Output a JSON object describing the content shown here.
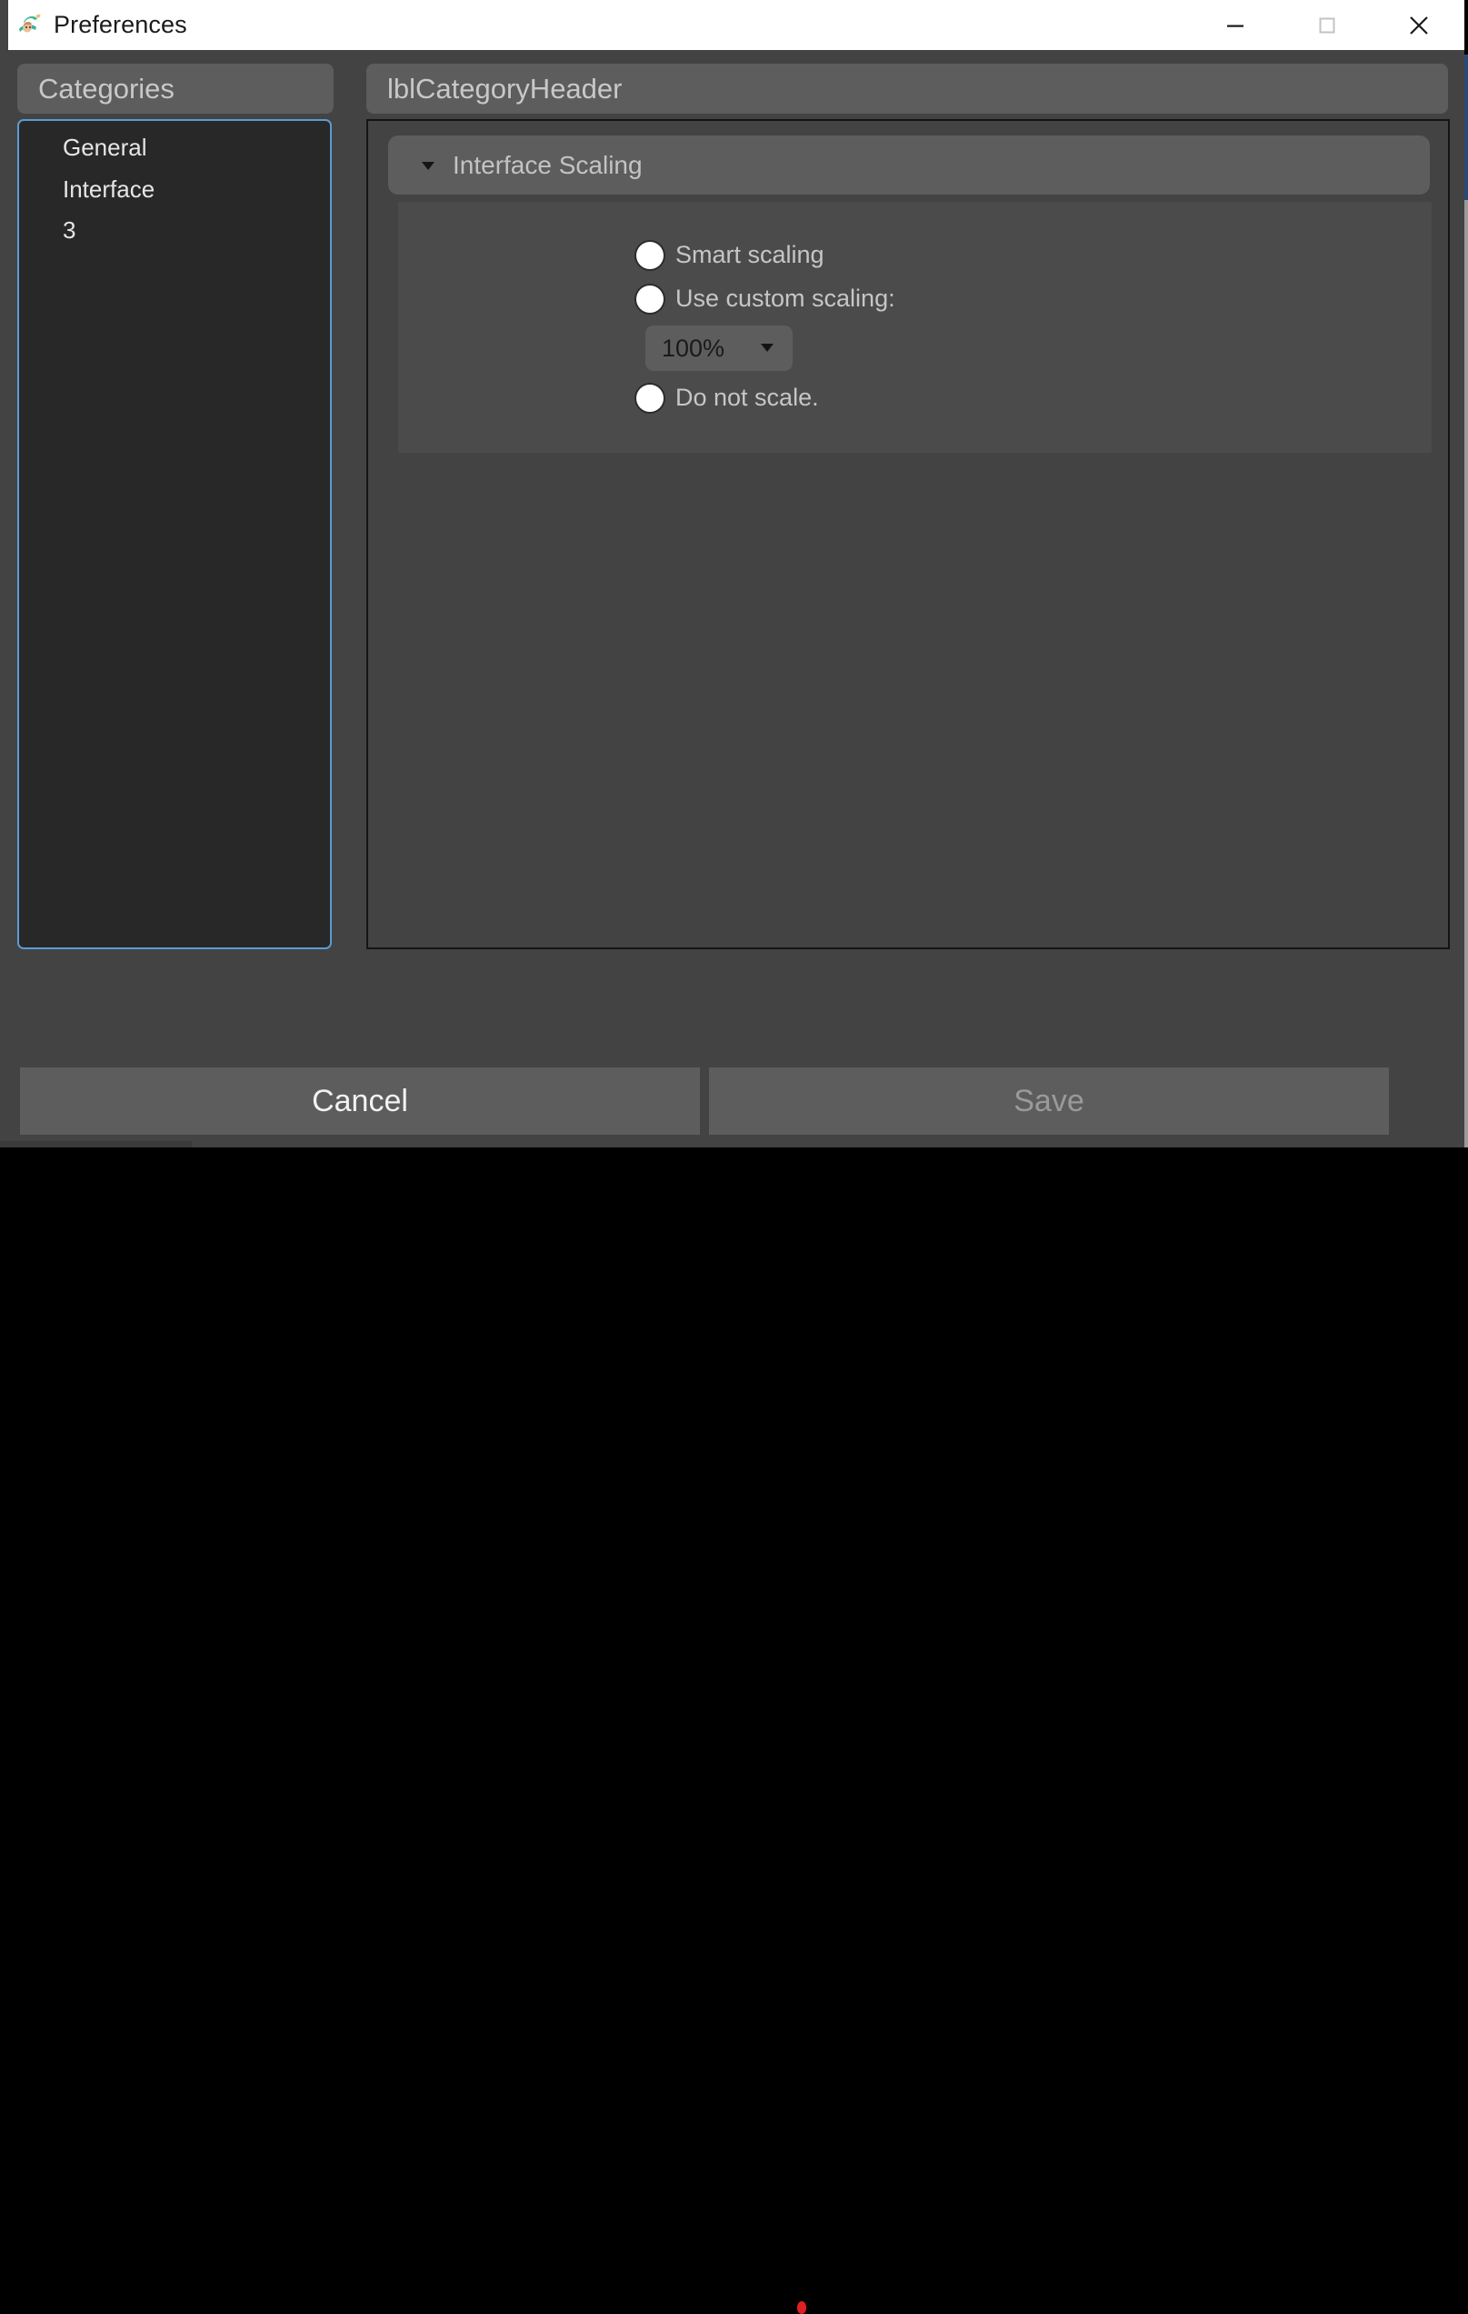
{
  "window": {
    "title": "Preferences",
    "app_icon": "robin-hood-hat-icon",
    "controls": {
      "minimize": "minimize-icon",
      "maximize": "maximize-icon",
      "close": "close-icon"
    }
  },
  "sidebar": {
    "header": "Categories",
    "items": [
      {
        "label": "General"
      },
      {
        "label": "Interface"
      },
      {
        "label": "3"
      }
    ]
  },
  "content": {
    "header": "lblCategoryHeader",
    "group": {
      "title": "Interface Scaling",
      "expanded": true,
      "caret": "chevron-down-icon",
      "options": [
        {
          "label": "Smart scaling",
          "selected": false
        },
        {
          "label": "Use custom scaling:",
          "selected": false
        },
        {
          "label": "Do not scale.",
          "selected": false
        }
      ],
      "scaling_combo": {
        "value": "100%",
        "caret": "chevron-down-icon"
      }
    }
  },
  "footer": {
    "cancel_label": "Cancel",
    "save_label": "Save"
  },
  "colors": {
    "window_bg": "#434343",
    "panel_raised": "#5d5d5d",
    "group_body": "#4b4b4b",
    "list_bg": "#282828",
    "focus_border": "#5b9bd5",
    "text_primary": "#e6e6e6",
    "text_muted": "#c3c3c3",
    "text_disabled": "#9a9a9a",
    "titlebar_bg": "#ffffff",
    "accent_red": "#e02020"
  }
}
